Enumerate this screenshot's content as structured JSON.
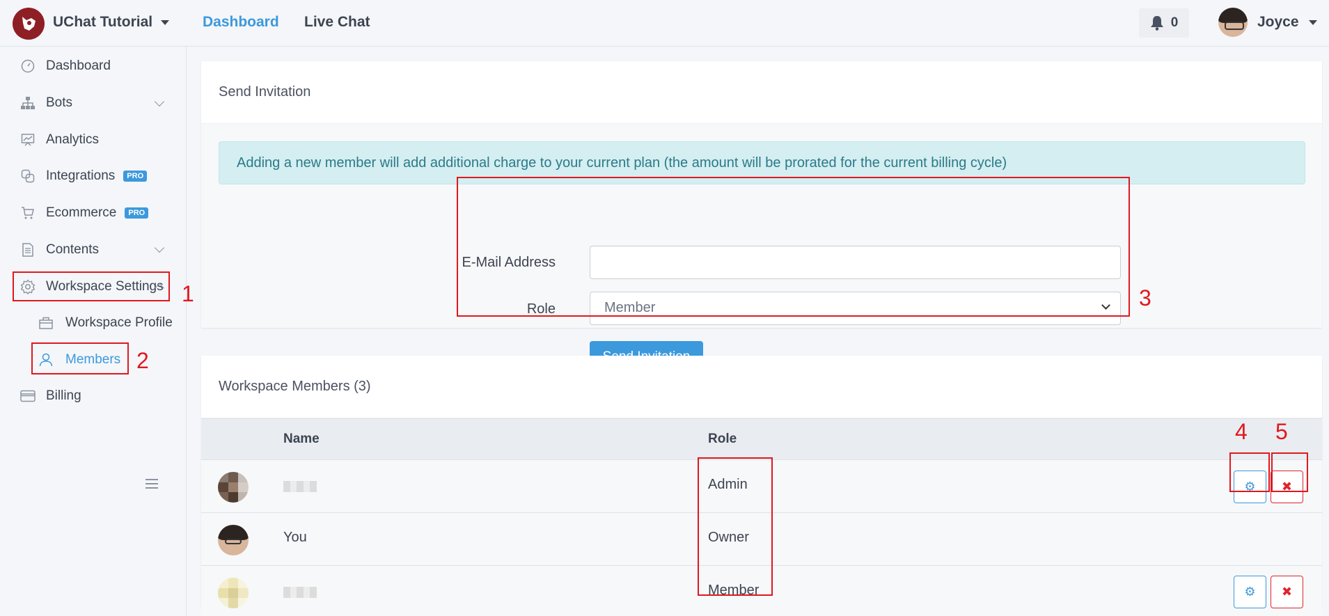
{
  "header": {
    "brand": "UChat Tutorial",
    "nav": [
      "Dashboard",
      "Live Chat"
    ],
    "notification_count": "0",
    "user_name": "Joyce"
  },
  "sidebar": {
    "items": [
      {
        "label": "Dashboard",
        "icon": "dashboard-icon"
      },
      {
        "label": "Bots",
        "icon": "sitemap-icon"
      },
      {
        "label": "Analytics",
        "icon": "chart-icon"
      },
      {
        "label": "Integrations",
        "icon": "link-icon",
        "badge": "PRO"
      },
      {
        "label": "Ecommerce",
        "icon": "cart-icon",
        "badge": "PRO"
      },
      {
        "label": "Contents",
        "icon": "document-icon"
      },
      {
        "label": "Workspace Settings",
        "icon": "gear-icon"
      },
      {
        "label": "Workspace Profile",
        "icon": "briefcase-icon"
      },
      {
        "label": "Members",
        "icon": "user-icon"
      },
      {
        "label": "Billing",
        "icon": "credit-card-icon"
      }
    ]
  },
  "invite": {
    "title": "Send Invitation",
    "alert": "Adding a new member will add additional charge to your current plan (the amount will be prorated for the current billing cycle)",
    "email_label": "E-Mail Address",
    "email_value": "",
    "role_label": "Role",
    "role_value": "Member",
    "submit": "Send Invitation"
  },
  "members": {
    "title": "Workspace Members (3)",
    "columns": [
      "Name",
      "Role"
    ],
    "rows": [
      {
        "name": "",
        "role": "Admin"
      },
      {
        "name": "You",
        "role": "Owner"
      },
      {
        "name": "",
        "role": "Member"
      }
    ],
    "action_gear": "⚙",
    "action_remove": "✖"
  },
  "annotations": [
    "1",
    "2",
    "3",
    "4",
    "5"
  ],
  "colors": {
    "accent": "#3c99dc",
    "danger": "#e0242c",
    "annotation": "#e0181e"
  }
}
